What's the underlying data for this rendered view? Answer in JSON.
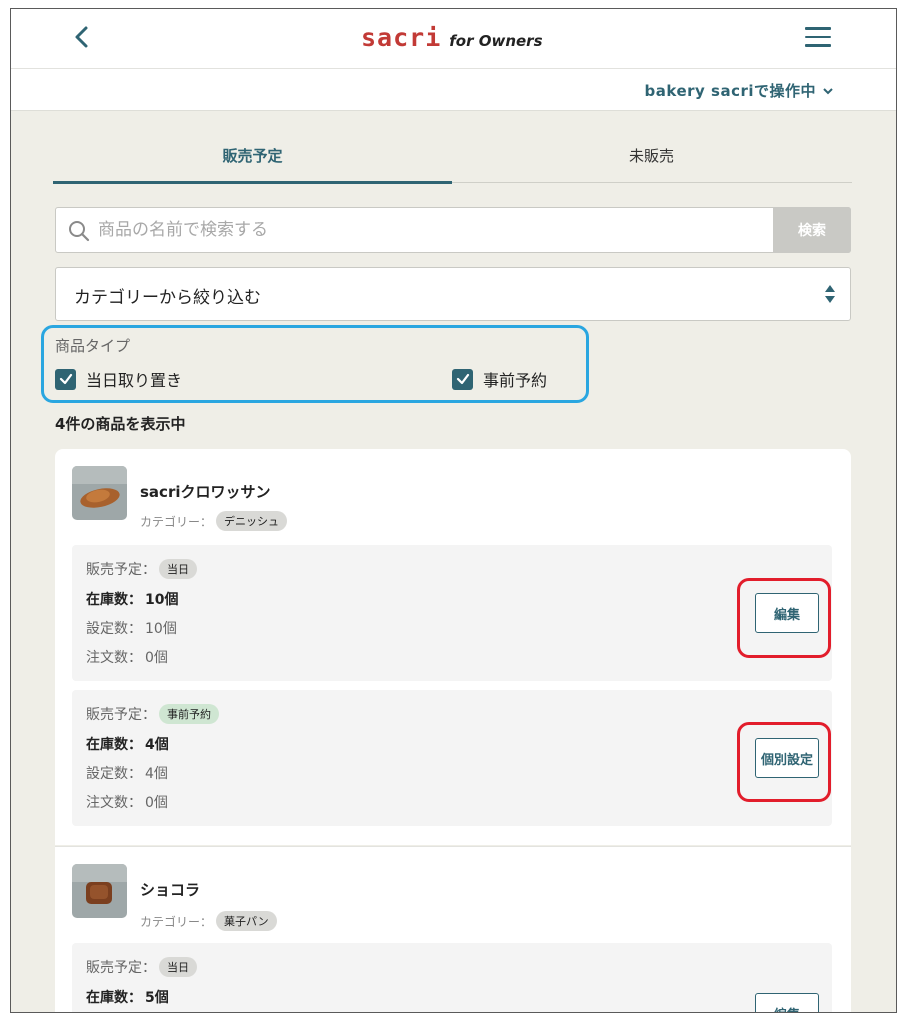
{
  "header": {
    "logo_main": "sacri",
    "logo_sub": "for Owners",
    "store_label": "bakery sacriで操作中"
  },
  "tabs": [
    {
      "label": "販売予定",
      "active": true
    },
    {
      "label": "未販売",
      "active": false
    }
  ],
  "search": {
    "placeholder": "商品の名前で検索する",
    "button_label": "検索"
  },
  "category_filter": {
    "label": "カテゴリーから絞り込む"
  },
  "product_type": {
    "label": "商品タイプ",
    "options": [
      {
        "label": "当日取り置き",
        "checked": true
      },
      {
        "label": "事前予約",
        "checked": true
      }
    ]
  },
  "result_count": "4件の商品を表示中",
  "products": [
    {
      "name": "sacriクロワッサン",
      "category_label": "カテゴリー：",
      "category": "デニッシュ",
      "schedules": [
        {
          "plan_label": "販売予定：",
          "plan": "当日",
          "stock_label": "在庫数：",
          "stock": "10個",
          "setting_label": "設定数：",
          "setting": "10個",
          "order_label": "注文数：",
          "order": "0個",
          "button": "編集"
        },
        {
          "plan_label": "販売予定：",
          "plan": "事前予約",
          "stock_label": "在庫数：",
          "stock": "4個",
          "setting_label": "設定数：",
          "setting": "4個",
          "order_label": "注文数：",
          "order": "0個",
          "button": "個別設定"
        }
      ]
    },
    {
      "name": "ショコラ",
      "category_label": "カテゴリー：",
      "category": "菓子パン",
      "schedules": [
        {
          "plan_label": "販売予定：",
          "plan": "当日",
          "stock_label": "在庫数：",
          "stock": "5個",
          "button": "編集"
        }
      ]
    }
  ],
  "colors": {
    "accent": "#2f6473",
    "logo_red": "#c23a36",
    "highlight_blue": "#2aa6e0",
    "highlight_red": "#e21d2b",
    "background": "#efeee7"
  }
}
